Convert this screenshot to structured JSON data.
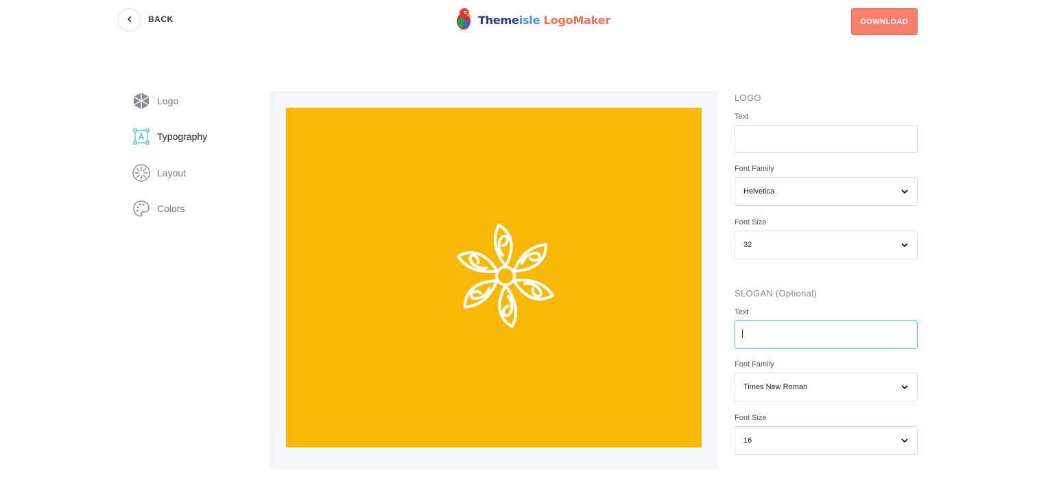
{
  "header": {
    "back_label": "BACK",
    "brand": {
      "part1": "Theme",
      "part2": "isle",
      "part3": " LogoMaker"
    },
    "download_label": "DOWNLOAD"
  },
  "sidebar": {
    "items": [
      {
        "label": "Logo",
        "icon": "hexagon-cube-icon",
        "active": false
      },
      {
        "label": "Typography",
        "icon": "typography-frame-icon",
        "active": true
      },
      {
        "label": "Layout",
        "icon": "layout-burst-icon",
        "active": false
      },
      {
        "label": "Colors",
        "icon": "palette-icon",
        "active": false
      }
    ]
  },
  "canvas": {
    "background_color": "#f8b803",
    "logo_icon": "spiral-flower-icon",
    "logo_color": "#ffffff"
  },
  "panel": {
    "logo_section": {
      "title": "LOGO",
      "text_label": "Text",
      "text_value": "",
      "font_family_label": "Font Family",
      "font_family_value": "Helvetica",
      "font_size_label": "Font Size",
      "font_size_value": "32"
    },
    "slogan_section": {
      "title": "SLOGAN (Optional)",
      "text_label": "Text",
      "text_value": "",
      "font_family_label": "Font Family",
      "font_family_value": "Times New Roman",
      "font_size_label": "Font Size",
      "font_size_value": "16"
    }
  },
  "colors": {
    "accent": "#f6806c",
    "focus": "#44c7c4",
    "active_icon": "#44c7c4"
  }
}
